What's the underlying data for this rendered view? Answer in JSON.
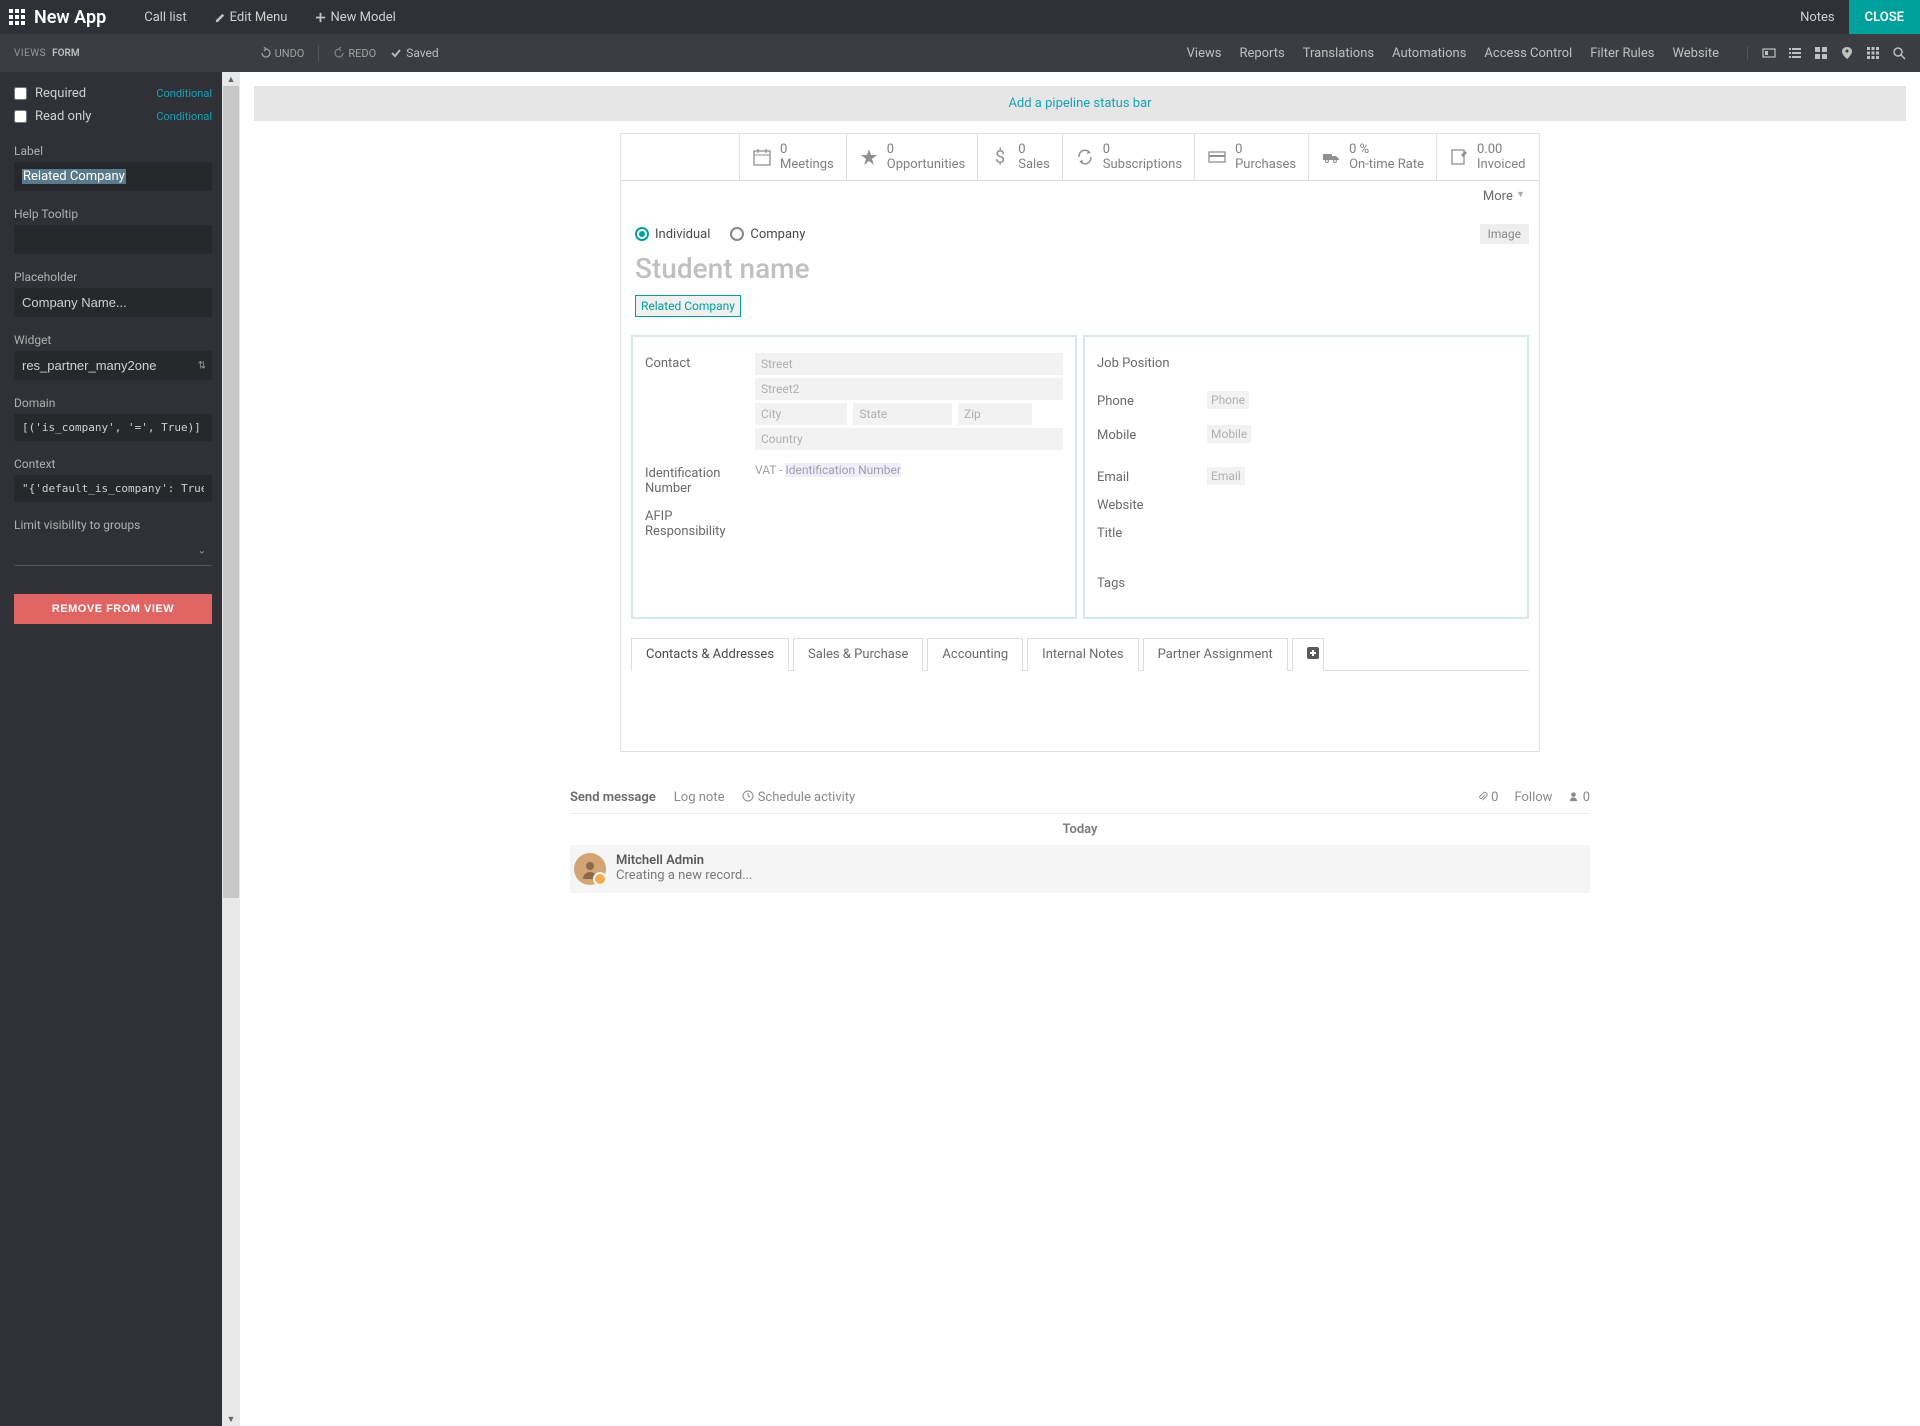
{
  "topbar": {
    "app_name": "New App",
    "menu": {
      "call_list": "Call list",
      "edit_menu": "Edit Menu",
      "new_model": "New Model"
    },
    "notes": "Notes",
    "close": "CLOSE"
  },
  "subbar": {
    "views": "VIEWS",
    "form": "FORM",
    "undo": "UNDO",
    "redo": "REDO",
    "saved": "Saved",
    "nav": {
      "views": "Views",
      "reports": "Reports",
      "translations": "Translations",
      "automations": "Automations",
      "access_control": "Access Control",
      "filter_rules": "Filter Rules",
      "website": "Website"
    }
  },
  "sidebar": {
    "required": "Required",
    "readonly": "Read only",
    "conditional": "Conditional",
    "label_label": "Label",
    "label_value": "Related Company",
    "help_tooltip_label": "Help Tooltip",
    "help_tooltip_value": "",
    "placeholder_label": "Placeholder",
    "placeholder_value": "Company Name...",
    "widget_label": "Widget",
    "widget_value": "res_partner_many2one",
    "domain_label": "Domain",
    "domain_value": "[('is_company', '=', True)]",
    "context_label": "Context",
    "context_value": "\"{'default_is_company': True, 'show_v",
    "limit_label": "Limit visibility to groups",
    "limit_value": "",
    "remove": "REMOVE FROM VIEW"
  },
  "content": {
    "pipeline": "Add a pipeline status bar",
    "stats": [
      {
        "val": "0",
        "lbl": "Meetings",
        "icon": "calendar"
      },
      {
        "val": "0",
        "lbl": "Opportunities",
        "icon": "star"
      },
      {
        "val": "0",
        "lbl": "Sales",
        "icon": "dollar"
      },
      {
        "val": "0",
        "lbl": "Subscriptions",
        "icon": "refresh"
      },
      {
        "val": "0",
        "lbl": "Purchases",
        "icon": "card"
      },
      {
        "val": "0 %",
        "lbl": "On-time Rate",
        "icon": "truck"
      },
      {
        "val": "0.00",
        "lbl": "Invoiced",
        "icon": "edit"
      }
    ],
    "more": "More",
    "type": {
      "individual": "Individual",
      "company": "Company"
    },
    "image": "Image",
    "student_name": "Student name",
    "related_company": "Related Company",
    "left": {
      "contact": "Contact",
      "street": "Street",
      "street2": "Street2",
      "city": "City",
      "state": "State",
      "zip": "Zip",
      "country": "Country",
      "idnum": "Identification Number",
      "vat": "VAT",
      "idnum_ph": "Identification Number",
      "afip": "AFIP Responsibility"
    },
    "right": {
      "job": "Job Position",
      "phone": "Phone",
      "phone_ph": "Phone",
      "mobile": "Mobile",
      "mobile_ph": "Mobile",
      "email": "Email",
      "email_ph": "Email",
      "website": "Website",
      "title": "Title",
      "tags": "Tags"
    },
    "tabs": [
      "Contacts & Addresses",
      "Sales & Purchase",
      "Accounting",
      "Internal Notes",
      "Partner Assignment"
    ]
  },
  "chatter": {
    "send": "Send message",
    "log": "Log note",
    "schedule": "Schedule activity",
    "attach_count": "0",
    "follow": "Follow",
    "follower_count": "0",
    "today": "Today",
    "author": "Mitchell Admin",
    "msg": "Creating a new record..."
  }
}
